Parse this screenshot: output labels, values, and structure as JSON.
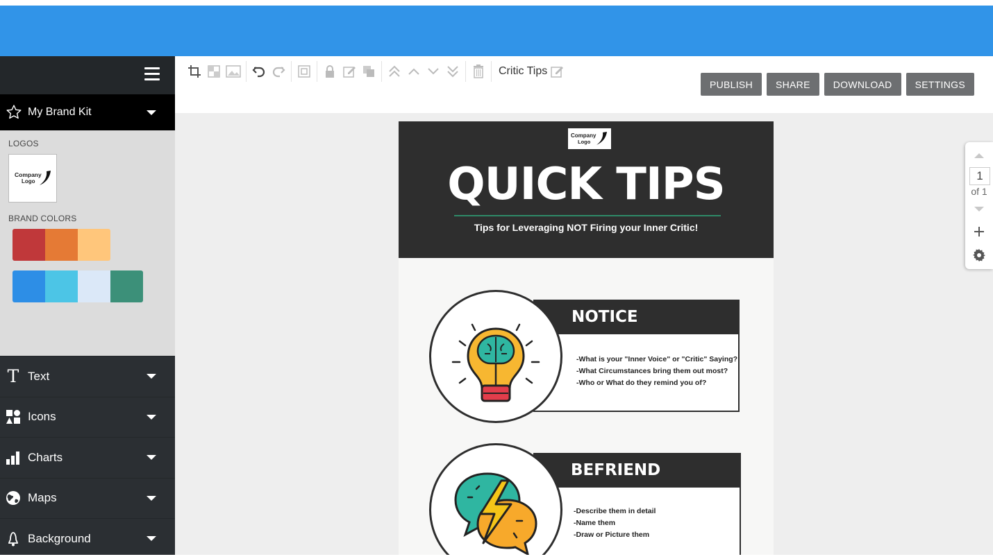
{
  "toolbar": {
    "doc_title": "Critic Tips",
    "buttons": [
      "PUBLISH",
      "SHARE",
      "DOWNLOAD",
      "SETTINGS"
    ]
  },
  "sidebar": {
    "brand_kit_label": "My Brand Kit",
    "logos_label": "LOGOS",
    "logo_text": "Company Logo",
    "brand_colors_label": "BRAND COLORS",
    "brand_colors_row1": [
      "#c0383a",
      "#e57a35",
      "#ffc67b"
    ],
    "brand_colors_row2": [
      "#2d8ee6",
      "#4cc5e6",
      "#dbe8f8",
      "#3c9079"
    ],
    "items": [
      {
        "label": "Text",
        "icon": "text-icon"
      },
      {
        "label": "Icons",
        "icon": "icons-icon"
      },
      {
        "label": "Charts",
        "icon": "chart-icon"
      },
      {
        "label": "Maps",
        "icon": "globe-icon"
      },
      {
        "label": "Background",
        "icon": "bucket-icon"
      }
    ]
  },
  "document": {
    "logo_text": "Company Logo",
    "title": "QUICK TIPS",
    "subtitle": "Tips for Leveraging NOT Firing your Inner Critic!",
    "tips": [
      {
        "heading": "NOTICE",
        "lines": [
          "-What is your \"Inner Voice\" or \"Critic\" Saying?",
          "-What Circumstances bring them out most?",
          "-Who or What do they remind you of?"
        ]
      },
      {
        "heading": "BEFRIEND",
        "lines": [
          "-Describe them in detail",
          "-Name them",
          "-Draw or Picture them"
        ]
      }
    ]
  },
  "pager": {
    "current": "1",
    "of": "of 1"
  },
  "colors": {
    "top_bar": "#3194e8",
    "sidebar": "#2b2f33",
    "doc_dark": "#2e2e2e",
    "accent_green": "#2e8b68"
  }
}
